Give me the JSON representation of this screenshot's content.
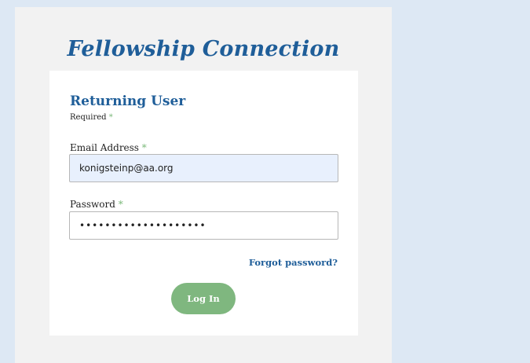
{
  "site": {
    "title": "Fellowship Connection"
  },
  "login": {
    "heading": "Returning User",
    "required_note": "Required",
    "required_mark": "*",
    "email": {
      "label": "Email Address",
      "value": "konigsteinp@aa.org"
    },
    "password": {
      "label": "Password",
      "value": "••••••••••••••••••••"
    },
    "forgot_label": "Forgot password?",
    "submit_label": "Log In"
  },
  "colors": {
    "page_background": "#dde8f4",
    "brand_blue": "#1f5e99",
    "button_green": "#7fb77f",
    "required_star": "#7bb97a",
    "autofill_background": "#e8f0fd"
  }
}
